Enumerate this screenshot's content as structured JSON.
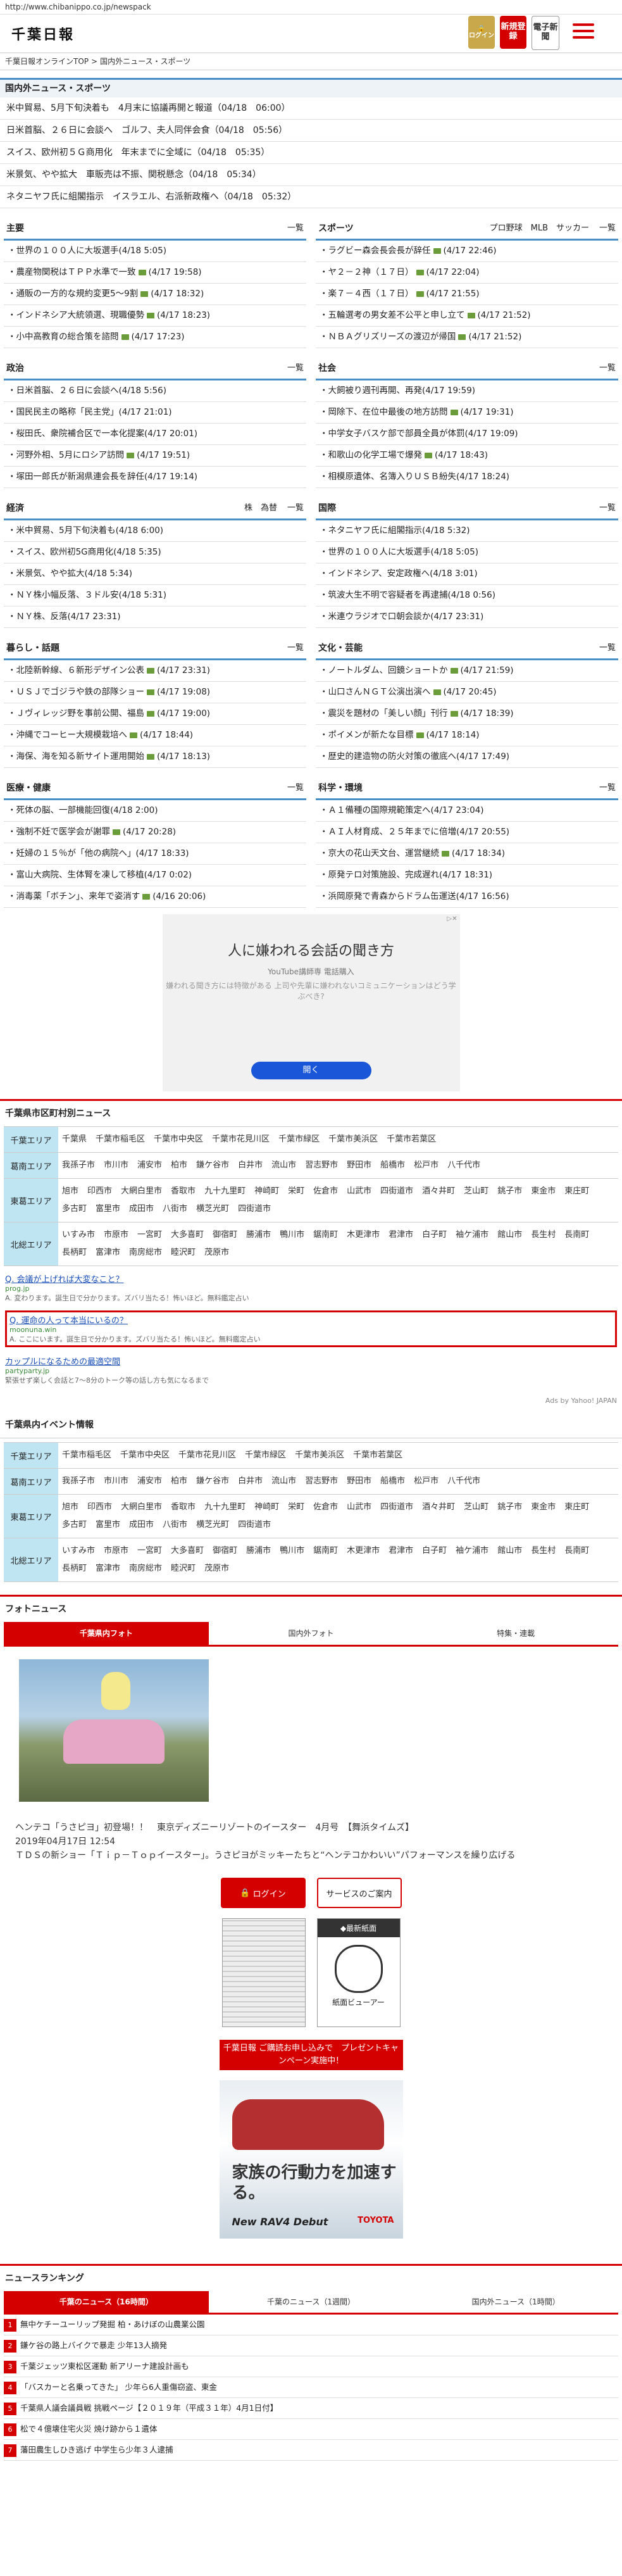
{
  "url": "http://www.chibanippo.co.jp/newspack",
  "header": {
    "logo": "千葉日報",
    "login_label": "ログイン",
    "register_label": "新規登録",
    "paper_label": "電子新聞"
  },
  "breadcrumb": [
    "千葉日報オンラインTOP",
    "国内外ニュース・スポーツ"
  ],
  "top_section": {
    "title": "国内外ニュース・スポーツ",
    "items": [
      "米中貿易、5月下旬決着も　4月末に協議再開と報道（04/18　06:00）",
      "日米首脳、２６日に会談へ　ゴルフ、夫人同伴会食（04/18　05:56）",
      "スイス、欧州初５Ｇ商用化　年末までに全域に（04/18　05:35）",
      "米景気、やや拡大　車販売は不振、関税懸念（04/18　05:34）",
      "ネタニヤフ氏に組閣指示　イスラエル、右派新政権へ（04/18　05:32）"
    ]
  },
  "blocks": [
    [
      {
        "title": "主要",
        "extra": "",
        "more": "一覧",
        "items": [
          {
            "text": "世界の１００人に大坂選手",
            "date": "(4/18 5:05)",
            "cam": false
          },
          {
            "text": "農産物関税はＴＰＰ水準で一致",
            "date": "(4/17 19:58)",
            "cam": true
          },
          {
            "text": "通販の一方的な規約変更5～9割",
            "date": "(4/17 18:32)",
            "cam": true
          },
          {
            "text": "インドネシア大統領選、現職優勢",
            "date": "(4/17 18:23)",
            "cam": true
          },
          {
            "text": "小中高教育の総合策を諮問",
            "date": "(4/17 17:23)",
            "cam": true
          }
        ]
      },
      {
        "title": "スポーツ",
        "extra": "プロ野球　MLB　サッカー",
        "more": "一覧",
        "items": [
          {
            "text": "ラグビー森会長会長が辞任",
            "date": "(4/17 22:46)",
            "cam": true
          },
          {
            "text": "ヤ２－２神（１７日）",
            "date": "(4/17 22:04)",
            "cam": true
          },
          {
            "text": "楽７－４西（１７日）",
            "date": "(4/17 21:55)",
            "cam": true
          },
          {
            "text": "五輪選考の男女差不公平と申し立て",
            "date": "(4/17 21:52)",
            "cam": true
          },
          {
            "text": "ＮＢＡグリズリーズの渡辺が帰国",
            "date": "(4/17 21:52)",
            "cam": true
          }
        ]
      }
    ],
    [
      {
        "title": "政治",
        "extra": "",
        "more": "一覧",
        "items": [
          {
            "text": "日米首脳、２６日に会談へ",
            "date": "(4/18 5:56)",
            "cam": false
          },
          {
            "text": "国民民主の略称「民主党」",
            "date": "(4/17 21:01)",
            "cam": false
          },
          {
            "text": "桜田氏、衆院補合区で一本化提案",
            "date": "(4/17 20:01)",
            "cam": false
          },
          {
            "text": "河野外相、5月にロシア訪問",
            "date": "(4/17 19:51)",
            "cam": true
          },
          {
            "text": "塚田一郎氏が新潟県連会長を辞任",
            "date": "(4/17 19:14)",
            "cam": false
          }
        ]
      },
      {
        "title": "社会",
        "extra": "",
        "more": "一覧",
        "items": [
          {
            "text": "大飼被り週刊再開、再発",
            "date": "(4/17 19:59)",
            "cam": false
          },
          {
            "text": "岡除下、在位中最後の地方訪問",
            "date": "(4/17 19:31)",
            "cam": true
          },
          {
            "text": "中学女子バスケ部で部員全員が体罰",
            "date": "(4/17 19:09)",
            "cam": false
          },
          {
            "text": "和歌山の化学工場で爆発",
            "date": "(4/17 18:43)",
            "cam": true
          },
          {
            "text": "相模原遺体、名簿入りＵＳＢ紛失",
            "date": "(4/17 18:24)",
            "cam": false
          }
        ]
      }
    ],
    [
      {
        "title": "経済",
        "extra": "株　為替",
        "more": "一覧",
        "items": [
          {
            "text": "米中貿易、5月下旬決着も",
            "date": "(4/18 6:00)",
            "cam": false
          },
          {
            "text": "スイス、欧州初5G商用化",
            "date": "(4/18 5:35)",
            "cam": false
          },
          {
            "text": "米景気、やや拡大",
            "date": "(4/18 5:34)",
            "cam": false
          },
          {
            "text": "ＮＹ株小幅反落、３ドル安",
            "date": "(4/18 5:31)",
            "cam": false
          },
          {
            "text": "ＮＹ株、反落",
            "date": "(4/17 23:31)",
            "cam": false
          }
        ]
      },
      {
        "title": "国際",
        "extra": "",
        "more": "一覧",
        "items": [
          {
            "text": "ネタニヤフ氏に組閣指示",
            "date": "(4/18 5:32)",
            "cam": false
          },
          {
            "text": "世界の１００人に大坂選手",
            "date": "(4/18 5:05)",
            "cam": false
          },
          {
            "text": "インドネシア、安定政権へ",
            "date": "(4/18 3:01)",
            "cam": false
          },
          {
            "text": "筑波大生不明で容疑者を再逮捕",
            "date": "(4/18 0:56)",
            "cam": false
          },
          {
            "text": "米連ウラジオで口朝会談か",
            "date": "(4/17 23:31)",
            "cam": false
          }
        ]
      }
    ],
    [
      {
        "title": "暮らし・話題",
        "extra": "",
        "more": "一覧",
        "items": [
          {
            "text": "北陸新幹線、６新形デザイン公表",
            "date": "(4/17 23:31)",
            "cam": true
          },
          {
            "text": "ＵＳＪでゴジラや鉄の部隊ショー",
            "date": "(4/17 19:08)",
            "cam": true
          },
          {
            "text": "Ｊヴィレッジ野を事前公開、福島",
            "date": "(4/17 19:00)",
            "cam": true
          },
          {
            "text": "沖縄でコーヒー大規模栽培へ",
            "date": "(4/17 18:44)",
            "cam": true
          },
          {
            "text": "海保、海を知る新サイト運用開始",
            "date": "(4/17 18:13)",
            "cam": true
          }
        ]
      },
      {
        "title": "文化・芸能",
        "extra": "",
        "more": "一覧",
        "items": [
          {
            "text": "ノートルダム、回鏡ショートか",
            "date": "(4/17 21:59)",
            "cam": true
          },
          {
            "text": "山口さんＮＧＴ公演出演へ",
            "date": "(4/17 20:45)",
            "cam": true
          },
          {
            "text": "震災を題材の「美しい顔」刊行",
            "date": "(4/17 18:39)",
            "cam": true
          },
          {
            "text": "ポイメンが新たな目標",
            "date": "(4/17 18:14)",
            "cam": true
          },
          {
            "text": "歴史的建造物の防火対策の徹底へ",
            "date": "(4/17 17:49)",
            "cam": false
          }
        ]
      }
    ],
    [
      {
        "title": "医療・健康",
        "extra": "",
        "more": "一覧",
        "items": [
          {
            "text": "死体の脳、一部機能回復",
            "date": "(4/18 2:00)",
            "cam": false
          },
          {
            "text": "強制不妊で医学会が謝罪",
            "date": "(4/17 20:28)",
            "cam": true
          },
          {
            "text": "妊婦の１５％が「他の病院へ」",
            "date": "(4/17 18:33)",
            "cam": false
          },
          {
            "text": "富山大病院、生体腎を凍して移植",
            "date": "(4/17 0:02)",
            "cam": false
          },
          {
            "text": "消毒薬「ボチン」、来年で姿消す",
            "date": "(4/16 20:06)",
            "cam": true
          }
        ]
      },
      {
        "title": "科学・環境",
        "extra": "",
        "more": "一覧",
        "items": [
          {
            "text": "Ａ１備種の国際規範策定へ",
            "date": "(4/17 23:04)",
            "cam": false
          },
          {
            "text": "ＡＩ人材育成、２５年までに倍増",
            "date": "(4/17 20:55)",
            "cam": false
          },
          {
            "text": "京大の花山天文台、運営継続",
            "date": "(4/17 18:34)",
            "cam": true
          },
          {
            "text": "原発テロ対策施設、完成遅れ",
            "date": "(4/17 18:31)",
            "cam": false
          },
          {
            "text": "浜岡原発で青森からドラム缶運送",
            "date": "(4/17 16:56)",
            "cam": false
          }
        ]
      }
    ]
  ],
  "ad": {
    "mark": "▷✕",
    "title": "人に嫌われる会話の聞き方",
    "sub": "YouTube講師専 電話購入",
    "text": "嫌われる聞き方には特徴がある 上司や先輩に嫌われないコミュニケーションはどう学ぶべき?",
    "button": "開く"
  },
  "area_news": {
    "title": "千葉県市区町村別ニュース",
    "rows": [
      {
        "label": "千葉エリア",
        "cities": [
          "千葉県",
          "千葉市稲毛区",
          "千葉市中央区",
          "千葉市花見川区",
          "千葉市緑区",
          "千葉市美浜区",
          "千葉市若葉区"
        ]
      },
      {
        "label": "葛南エリア",
        "cities": [
          "我孫子市",
          "市川市",
          "浦安市",
          "柏市",
          "鎌ケ谷市",
          "白井市",
          "流山市",
          "習志野市",
          "野田市",
          "船橋市",
          "松戸市",
          "八千代市"
        ]
      },
      {
        "label": "東葛エリア",
        "cities": [
          "旭市",
          "印西市",
          "大網白里市",
          "香取市",
          "九十九里町",
          "神崎町",
          "栄町",
          "佐倉市",
          "山武市",
          "四街道市",
          "酒々井町",
          "芝山町",
          "銚子市",
          "東金市",
          "東庄町",
          "多古町",
          "富里市",
          "成田市",
          "八街市",
          "横芝光町",
          "四街道市"
        ]
      },
      {
        "label": "北総エリア",
        "cities": [
          "いすみ市",
          "市原市",
          "一宮町",
          "大多喜町",
          "御宿町",
          "勝浦市",
          "鴨川市",
          "鋸南町",
          "木更津市",
          "君津市",
          "白子町",
          "袖ケ浦市",
          "館山市",
          "長生村",
          "長南町",
          "長柄町",
          "富津市",
          "南房総市",
          "睦沢町",
          "茂原市"
        ]
      }
    ]
  },
  "text_ads": [
    {
      "title": "Q. 会議が上げれば大変なこと？",
      "domain": "prog.jp",
      "desc": "A. 変わります。誕生日で分かります。ズバリ当たる！怖いほど。無料鑑定占い",
      "highlight": false
    },
    {
      "title": "Q. 運命の人って本当にいるの？",
      "domain": "moonuna.win",
      "desc": "A. ここにいます。誕生日で分かります。ズバリ当たる！怖いほど。無料鑑定占い",
      "highlight": true
    },
    {
      "title": "カップルになるための最適空間",
      "domain": "partyparty.jp",
      "desc": "緊張せず楽しく会話と7〜8分のトーク等の話し方も気になるまで",
      "highlight": false
    }
  ],
  "ads_by": "Ads by Yahoo! JAPAN",
  "event_area": {
    "title": "千葉県内イベント情報",
    "rows": [
      {
        "label": "千葉エリア",
        "cities": [
          "千葉市稲毛区",
          "千葉市中央区",
          "千葉市花見川区",
          "千葉市緑区",
          "千葉市美浜区",
          "千葉市若葉区"
        ]
      },
      {
        "label": "葛南エリア",
        "cities": [
          "我孫子市",
          "市川市",
          "浦安市",
          "柏市",
          "鎌ケ谷市",
          "白井市",
          "流山市",
          "習志野市",
          "野田市",
          "船橋市",
          "松戸市",
          "八千代市"
        ]
      },
      {
        "label": "東葛エリア",
        "cities": [
          "旭市",
          "印西市",
          "大網白里市",
          "香取市",
          "九十九里町",
          "神崎町",
          "栄町",
          "佐倉市",
          "山武市",
          "四街道市",
          "酒々井町",
          "芝山町",
          "銚子市",
          "東金市",
          "東庄町",
          "多古町",
          "富里市",
          "成田市",
          "八街市",
          "横芝光町",
          "四街道市"
        ]
      },
      {
        "label": "北総エリア",
        "cities": [
          "いすみ市",
          "市原市",
          "一宮町",
          "大多喜町",
          "御宿町",
          "勝浦市",
          "鴨川市",
          "鋸南町",
          "木更津市",
          "君津市",
          "白子町",
          "袖ケ浦市",
          "館山市",
          "長生村",
          "長南町",
          "長柄町",
          "富津市",
          "南房総市",
          "睦沢町",
          "茂原市"
        ]
      }
    ]
  },
  "photo_news": {
    "title": "フォトニュース",
    "tabs": [
      "千葉県内フォト",
      "国内外フォト",
      "特集・連載"
    ],
    "caption": "ヘンテコ「うさピヨ」初登場！！　東京ディズニーリゾートのイースター　4月号　【舞浜タイムズ】",
    "date": "2019年04月17日 12:54",
    "desc": "ＴＤＳの新ショー「Ｔｉｐ－Ｔｏｐイースター」。うさピヨがミッキーたちと“ヘンテコかわいい”パフォーマンスを繰り広げる"
  },
  "side": {
    "login": "ログイン",
    "service": "サービスのご案内",
    "new_label": "◆最新紙面",
    "viewer": "紙面ビューアー",
    "campaign": "千葉日報 ご購読お申し込みで　プレゼントキャンペーン実施中！",
    "car_copy": "家族の行動力を加速する。",
    "car_model": "New RAV4 Debut",
    "car_brand": "TOYOTA"
  },
  "ranking": {
    "title": "ニュースランキング",
    "tabs": [
      "千葉のニュース（16時間）",
      "千葉のニュース（1週間）",
      "国内外ニュース（1時間）"
    ],
    "items": [
      "無中ケチーユーリップ発掘 柏・あけぼの山農業公園",
      "鎌ケ谷の路上バイクで暴走 少年13人摘発",
      "千葉ジェッツ東松区運動 新アリーナ建設計画も",
      "「バスカーと名乗ってきた」 少年ら6人重傷窃盗、東金",
      "千葉県人議会議員戦 挑戦ページ【２０１９年（平成３１年）4月1日付】",
      "松で４億壊住宅火災 焼け跡から１遺体",
      "藩田農生しひき逃げ 中学生ら少年３人逮捕"
    ]
  }
}
